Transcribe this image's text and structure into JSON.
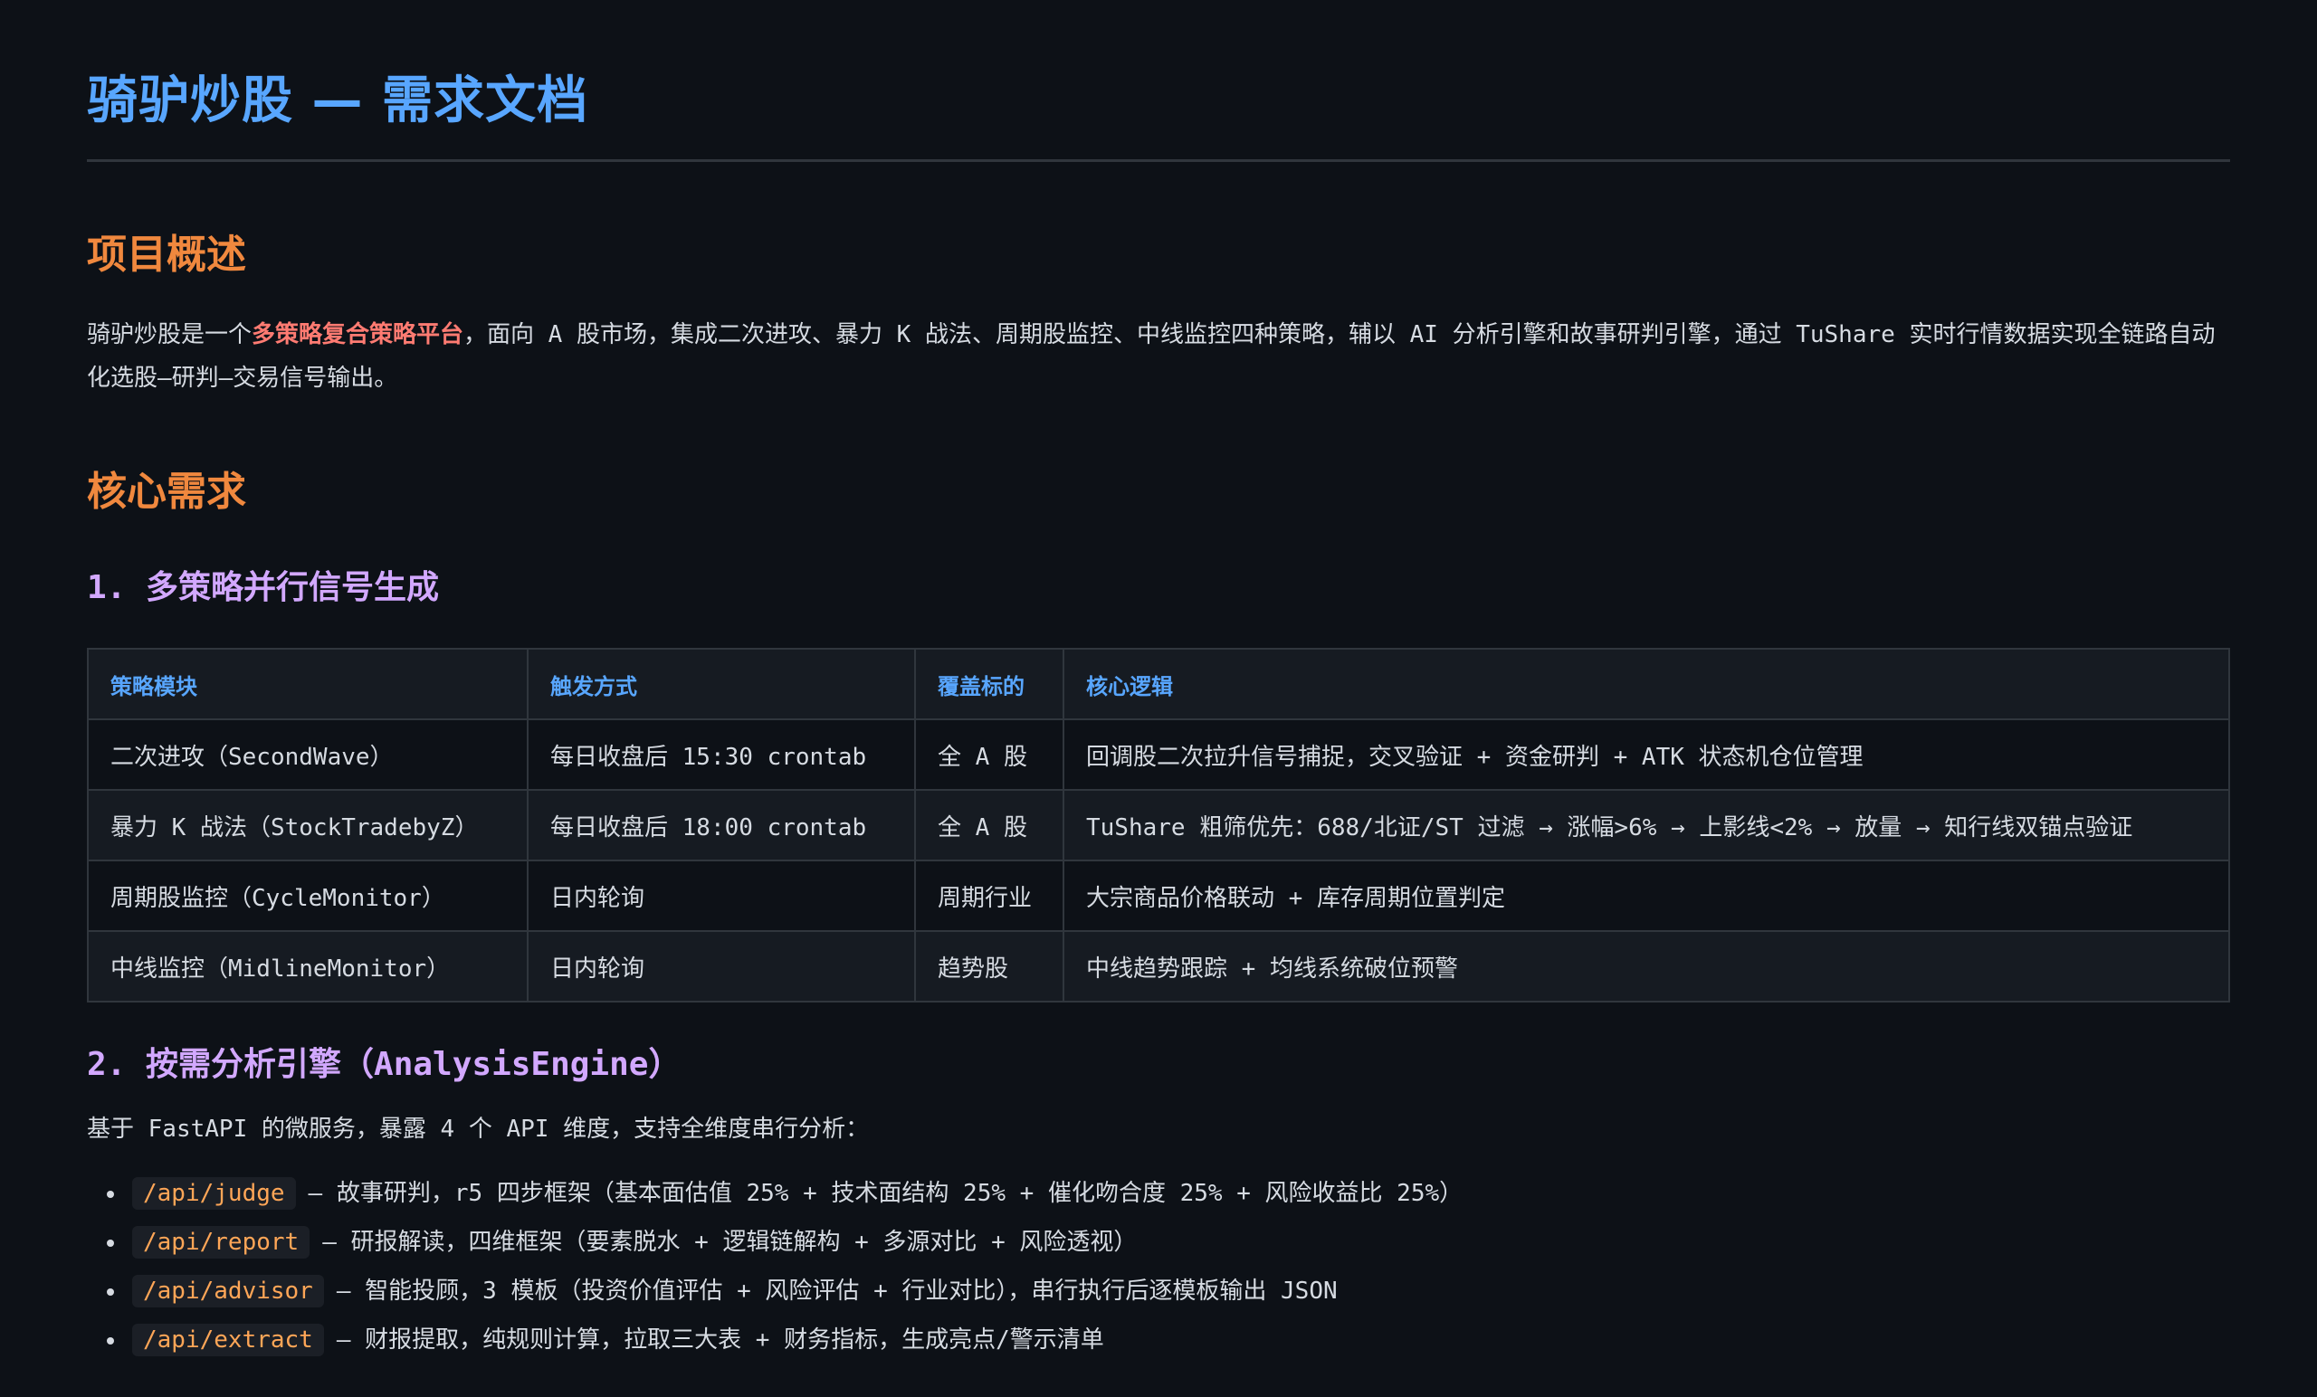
{
  "title": "骑驴炒股 — 需求文档",
  "overview": {
    "heading": "项目概述",
    "text_before": "骑驴炒股是一个",
    "highlight": "多策略复合策略平台",
    "text_after": "，面向 A 股市场，集成二次进攻、暴力 K 战法、周期股监控、中线监控四种策略，辅以 AI 分析引擎和故事研判引擎，通过 TuShare 实时行情数据实现全链路自动化选股—研判—交易信号输出。"
  },
  "core": {
    "heading": "核心需求",
    "section1": {
      "heading": "1. 多策略并行信号生成",
      "table": {
        "headers": [
          "策略模块",
          "触发方式",
          "覆盖标的",
          "核心逻辑"
        ],
        "rows": [
          [
            "二次进攻（SecondWave）",
            "每日收盘后 15:30 crontab",
            "全 A 股",
            "回调股二次拉升信号捕捉，交叉验证 + 资金研判 + ATK 状态机仓位管理"
          ],
          [
            "暴力 K 战法（StockTradebyZ）",
            "每日收盘后 18:00 crontab",
            "全 A 股",
            "TuShare 粗筛优先：688/北证/ST 过滤 → 涨幅>6% → 上影线<2% → 放量 → 知行线双锚点验证"
          ],
          [
            "周期股监控（CycleMonitor）",
            "日内轮询",
            "周期行业",
            "大宗商品价格联动 + 库存周期位置判定"
          ],
          [
            "中线监控（MidlineMonitor）",
            "日内轮询",
            "趋势股",
            "中线趋势跟踪 + 均线系统破位预警"
          ]
        ]
      }
    },
    "section2": {
      "heading": "2. 按需分析引擎（AnalysisEngine）",
      "intro": "基于 FastAPI 的微服务，暴露 4 个 API 维度，支持全维度串行分析：",
      "items": [
        {
          "code": "/api/judge",
          "text": "— 故事研判，r5 四步框架（基本面估值 25% + 技术面结构 25% + 催化吻合度 25% + 风险收益比 25%）"
        },
        {
          "code": "/api/report",
          "text": "— 研报解读，四维框架（要素脱水 + 逻辑链解构 + 多源对比 + 风险透视）"
        },
        {
          "code": "/api/advisor",
          "text": "— 智能投顾，3 模板（投资价值评估 + 风险评估 + 行业对比），串行执行后逐模板输出 JSON"
        },
        {
          "code": "/api/extract",
          "text": "— 财报提取，纯规则计算，拉取三大表 + 财务指标，生成亮点/警示清单"
        }
      ]
    }
  }
}
